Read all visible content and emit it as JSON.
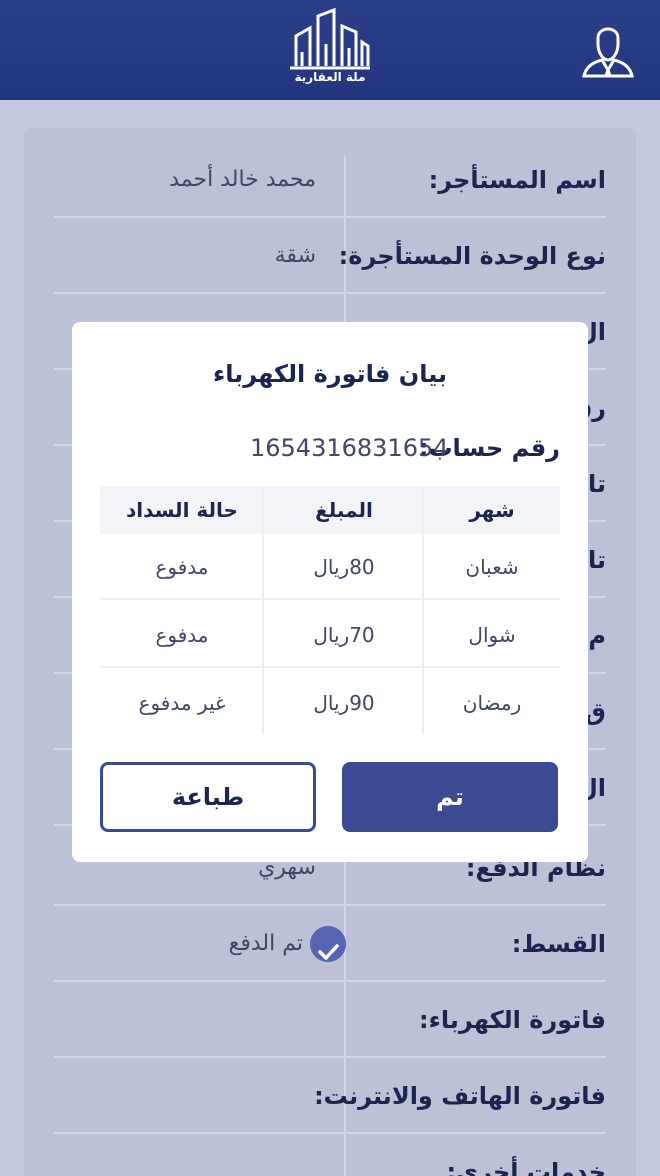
{
  "header": {
    "logo_text": "ملة العقارية",
    "profile_icon": "user-icon"
  },
  "details": {
    "rows": [
      {
        "label": "اسم المستأجر:",
        "value": "محمد خالد أحمد"
      },
      {
        "label": "نوع الوحدة المستأجرة:",
        "value": "شقة"
      },
      {
        "label": "ال",
        "value": ""
      },
      {
        "label": "رق",
        "value": ""
      },
      {
        "label": "تا",
        "value": ""
      },
      {
        "label": "تا",
        "value": ""
      },
      {
        "label": "م",
        "value": ""
      },
      {
        "label": "ق",
        "value": ""
      },
      {
        "label": "ال",
        "value": ""
      },
      {
        "label": "نظام الدفع:",
        "value": "سهري"
      },
      {
        "label": "القسط:",
        "value": "تم الدفع"
      },
      {
        "label": "فاتورة الكهرباء:",
        "value": ""
      },
      {
        "label": "فاتورة الهاتف والانترنت:",
        "value": ""
      },
      {
        "label": "خدمات أخرى:",
        "value": ""
      }
    ],
    "installment_status_icon": "check-circle-icon"
  },
  "modal": {
    "title": "بيان فاتورة الكهرباء",
    "account_label": "رقم حساب:",
    "account_number": "1654316831654",
    "table": {
      "headers": [
        "شهر",
        "المبلغ",
        "حالة السداد"
      ],
      "rows": [
        [
          "شعبان",
          "80ريال",
          "مدفوع"
        ],
        [
          "شوال",
          "70ريال",
          "مدفوع"
        ],
        [
          "رمضان",
          "90ريال",
          "غير مدفوع"
        ]
      ]
    },
    "ok_button": "تم",
    "print_button": "طباعة"
  }
}
